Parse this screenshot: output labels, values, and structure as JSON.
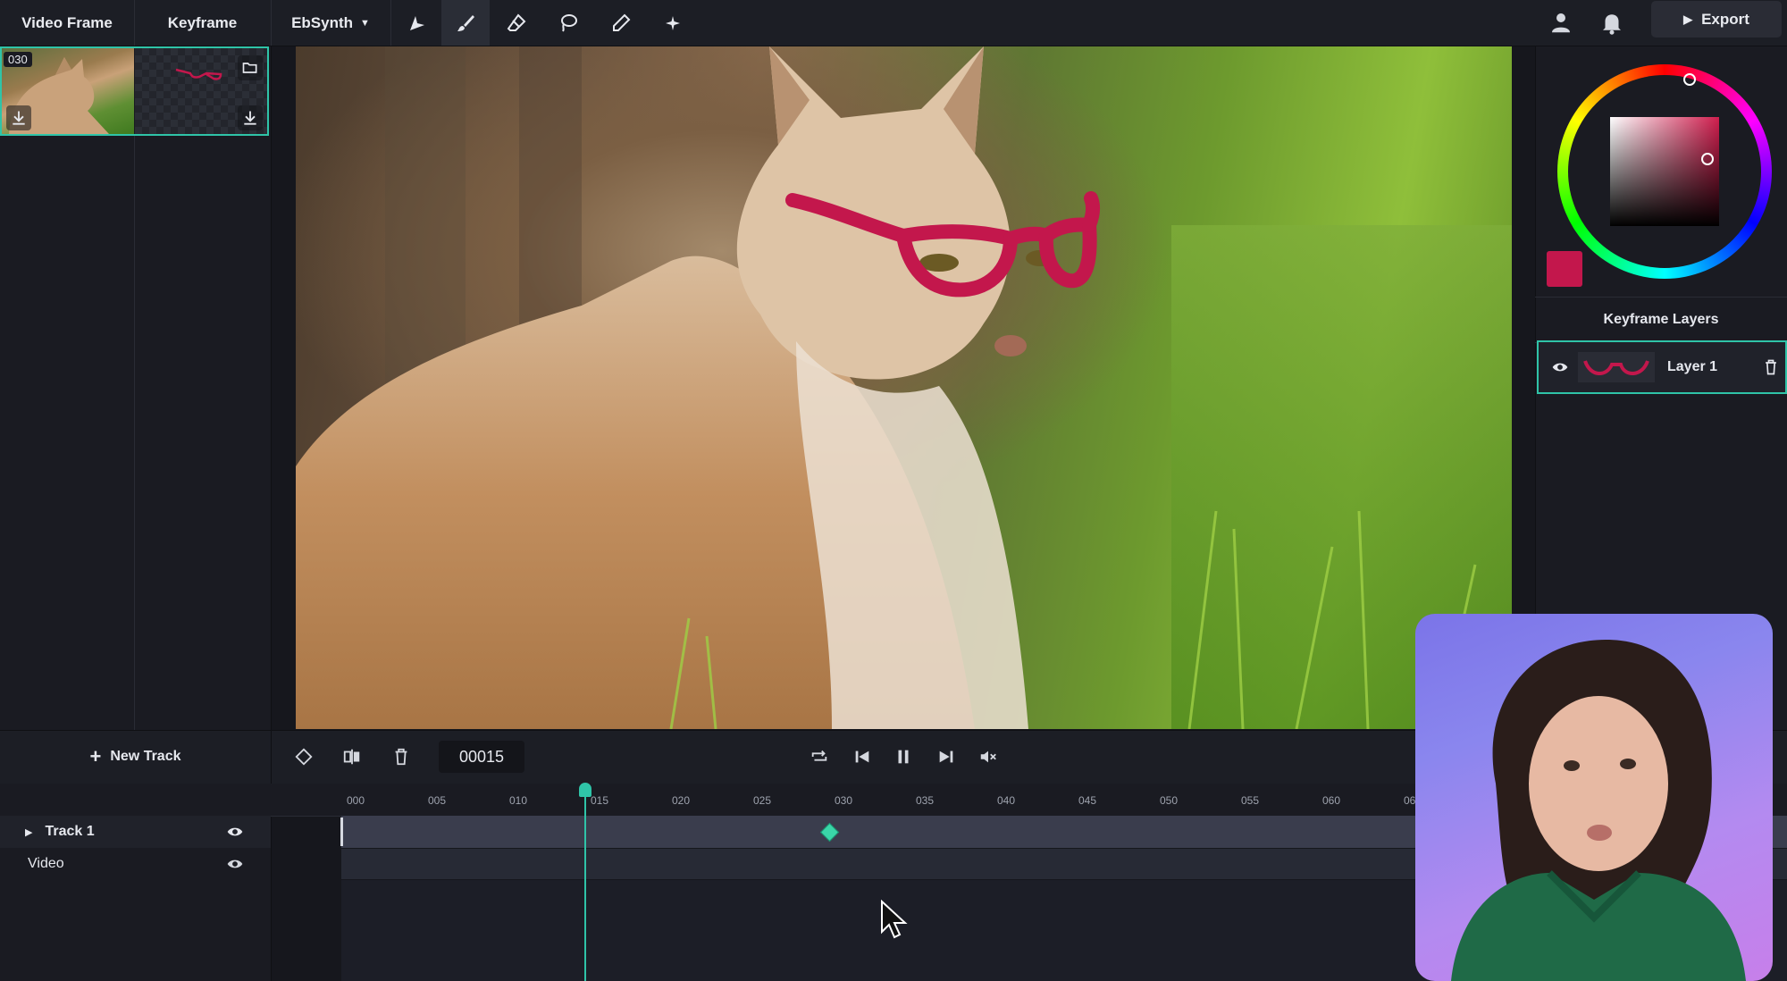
{
  "menu": {
    "video_frame": "Video Frame",
    "keyframe": "Keyframe",
    "ebsynth": "EbSynth"
  },
  "tools": [
    "select-icon",
    "brush-icon",
    "eraser-icon",
    "lasso-icon",
    "eyedropper-icon",
    "magic-icon"
  ],
  "active_tool": "brush-icon",
  "header_actions": {
    "export_label": "Export"
  },
  "keyframe_list": {
    "frame_number": "030"
  },
  "color_picker": {
    "selected_color": "#c3174c"
  },
  "layers_panel": {
    "title": "Keyframe Layers",
    "layers": [
      {
        "name": "Layer 1"
      }
    ]
  },
  "timeline": {
    "new_track_label": "New Track",
    "current_frame": "00015",
    "ticks": [
      "000",
      "005",
      "010",
      "015",
      "020",
      "025",
      "030",
      "035",
      "040",
      "045",
      "050",
      "055",
      "060",
      "06"
    ],
    "tracks": [
      {
        "name": "Track 1"
      },
      {
        "name": "Video"
      }
    ],
    "playhead_frame": 15,
    "keyframe_at": 30
  },
  "colors": {
    "accent": "#2fc4a8",
    "glasses": "#c3174c",
    "background": "#16171d"
  }
}
